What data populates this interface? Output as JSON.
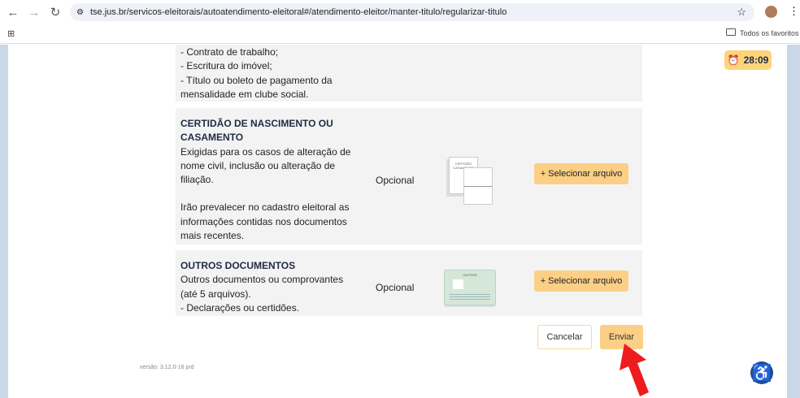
{
  "browser": {
    "url": "tse.jus.br/servicos-eleitorais/autoatendimento-eleitoral#/atendimento-eleitor/manter-titulo/regularizar-titulo",
    "bookmarks_label": "Todos os favoritos"
  },
  "timer": "28:09",
  "rows": [
    {
      "lines": [
        "- Contrato de trabalho;",
        "- Escritura do imóvel;",
        "- Título ou boleto de pagamento da",
        "mensalidade em clube social."
      ]
    },
    {
      "title1": "CERTIDÃO DE NASCIMENTO OU",
      "title2": "CASAMENTO",
      "lines": [
        "Exigidas para os casos de alteração de",
        "nome civil, inclusão ou alteração de",
        "filiação.",
        "",
        "Irão prevalecer no cadastro eleitoral as",
        "informações contidas nos documentos",
        "mais recentes."
      ],
      "status": "Opcional",
      "icon_text": "CERTIDÃO CASAMENTO",
      "button": "+ Selecionar arquivo"
    },
    {
      "title1": "OUTROS DOCUMENTOS",
      "lines": [
        "Outros documentos ou comprovantes",
        "(até 5 arquivos).",
        "- Declarações ou certidões."
      ],
      "status": "Opcional",
      "icon_text": "OUTROS",
      "button": "+ Selecionar arquivo"
    }
  ],
  "actions": {
    "cancel": "Cancelar",
    "submit": "Enviar"
  },
  "version": "versão: 3.12.0-16 prd"
}
